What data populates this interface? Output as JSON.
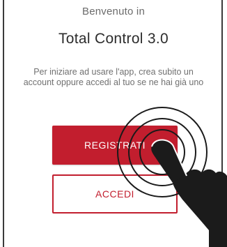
{
  "welcome": {
    "line": "Benvenuto in",
    "app_title": "Total Control 3.0"
  },
  "intro": {
    "text": "Per iniziare ad usare l'app, crea subito un account oppure accedi al tuo se ne hai già uno"
  },
  "actions": {
    "register_label": "REGISTRATI",
    "login_label": "ACCEDI"
  },
  "colors": {
    "brand_red": "#c21e2e",
    "background": "#ffffff"
  },
  "overlay": {
    "icon": "tap-gesture-icon"
  }
}
